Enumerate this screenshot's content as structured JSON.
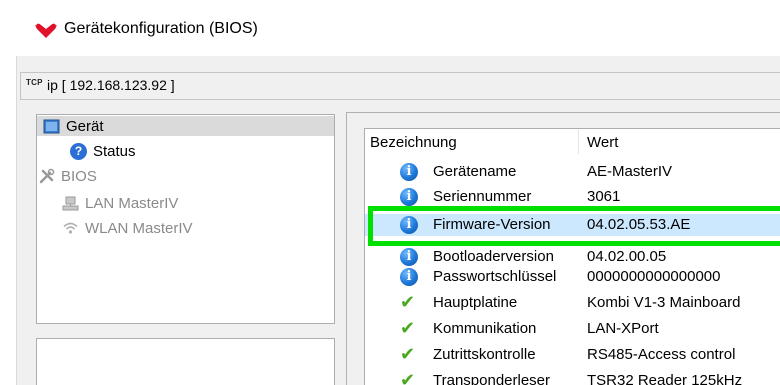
{
  "window": {
    "title": "Gerätekonfiguration (BIOS)",
    "icon": "red-heart-logo-icon",
    "accent_color": "#e0112b"
  },
  "address": {
    "protocol": "TCP",
    "text": "ip [ 192.168.123.92 ]"
  },
  "tree": {
    "items": [
      {
        "label": "Gerät",
        "icon": "device-icon",
        "selected": true,
        "enabled": true
      },
      {
        "label": "Status",
        "icon": "help-icon",
        "selected": false,
        "enabled": true
      },
      {
        "label": "BIOS",
        "icon": "tools-icon",
        "selected": false,
        "enabled": false
      },
      {
        "label": "LAN MasterIV",
        "icon": "network-icon",
        "selected": false,
        "enabled": false
      },
      {
        "label": "WLAN MasterIV",
        "icon": "wifi-icon",
        "selected": false,
        "enabled": false
      }
    ]
  },
  "table": {
    "columns": [
      "Bezeichnung",
      "Wert"
    ],
    "rows": [
      {
        "icon": "info-icon",
        "name": "Gerätename",
        "value": "AE-MasterIV"
      },
      {
        "icon": "info-icon",
        "name": "Seriennummer",
        "value": "3061"
      },
      {
        "icon": "info-icon",
        "name": "Firmware-Version",
        "value": "04.02.05.53.AE",
        "selected": true
      },
      {
        "icon": "info-icon",
        "name": "Bootloaderversion",
        "value": "04.02.00.05"
      },
      {
        "icon": "info-icon",
        "name": "Passwortschlüssel",
        "value": "0000000000000000"
      },
      {
        "icon": "check-icon",
        "name": "Hauptplatine",
        "value": "Kombi V1-3 Mainboard"
      },
      {
        "icon": "check-icon",
        "name": "Kommunikation",
        "value": "LAN-XPort"
      },
      {
        "icon": "check-icon",
        "name": "Zutrittskontrolle",
        "value": "RS485-Access control"
      },
      {
        "icon": "check-icon",
        "name": "Transponderleser",
        "value": "TSR32 Reader 125kHz"
      }
    ]
  },
  "colors": {
    "selection_bg": "#cce8ff",
    "highlight_border": "#00e000",
    "check_green": "#4aa81e",
    "info_blue": "#1e78d8"
  }
}
